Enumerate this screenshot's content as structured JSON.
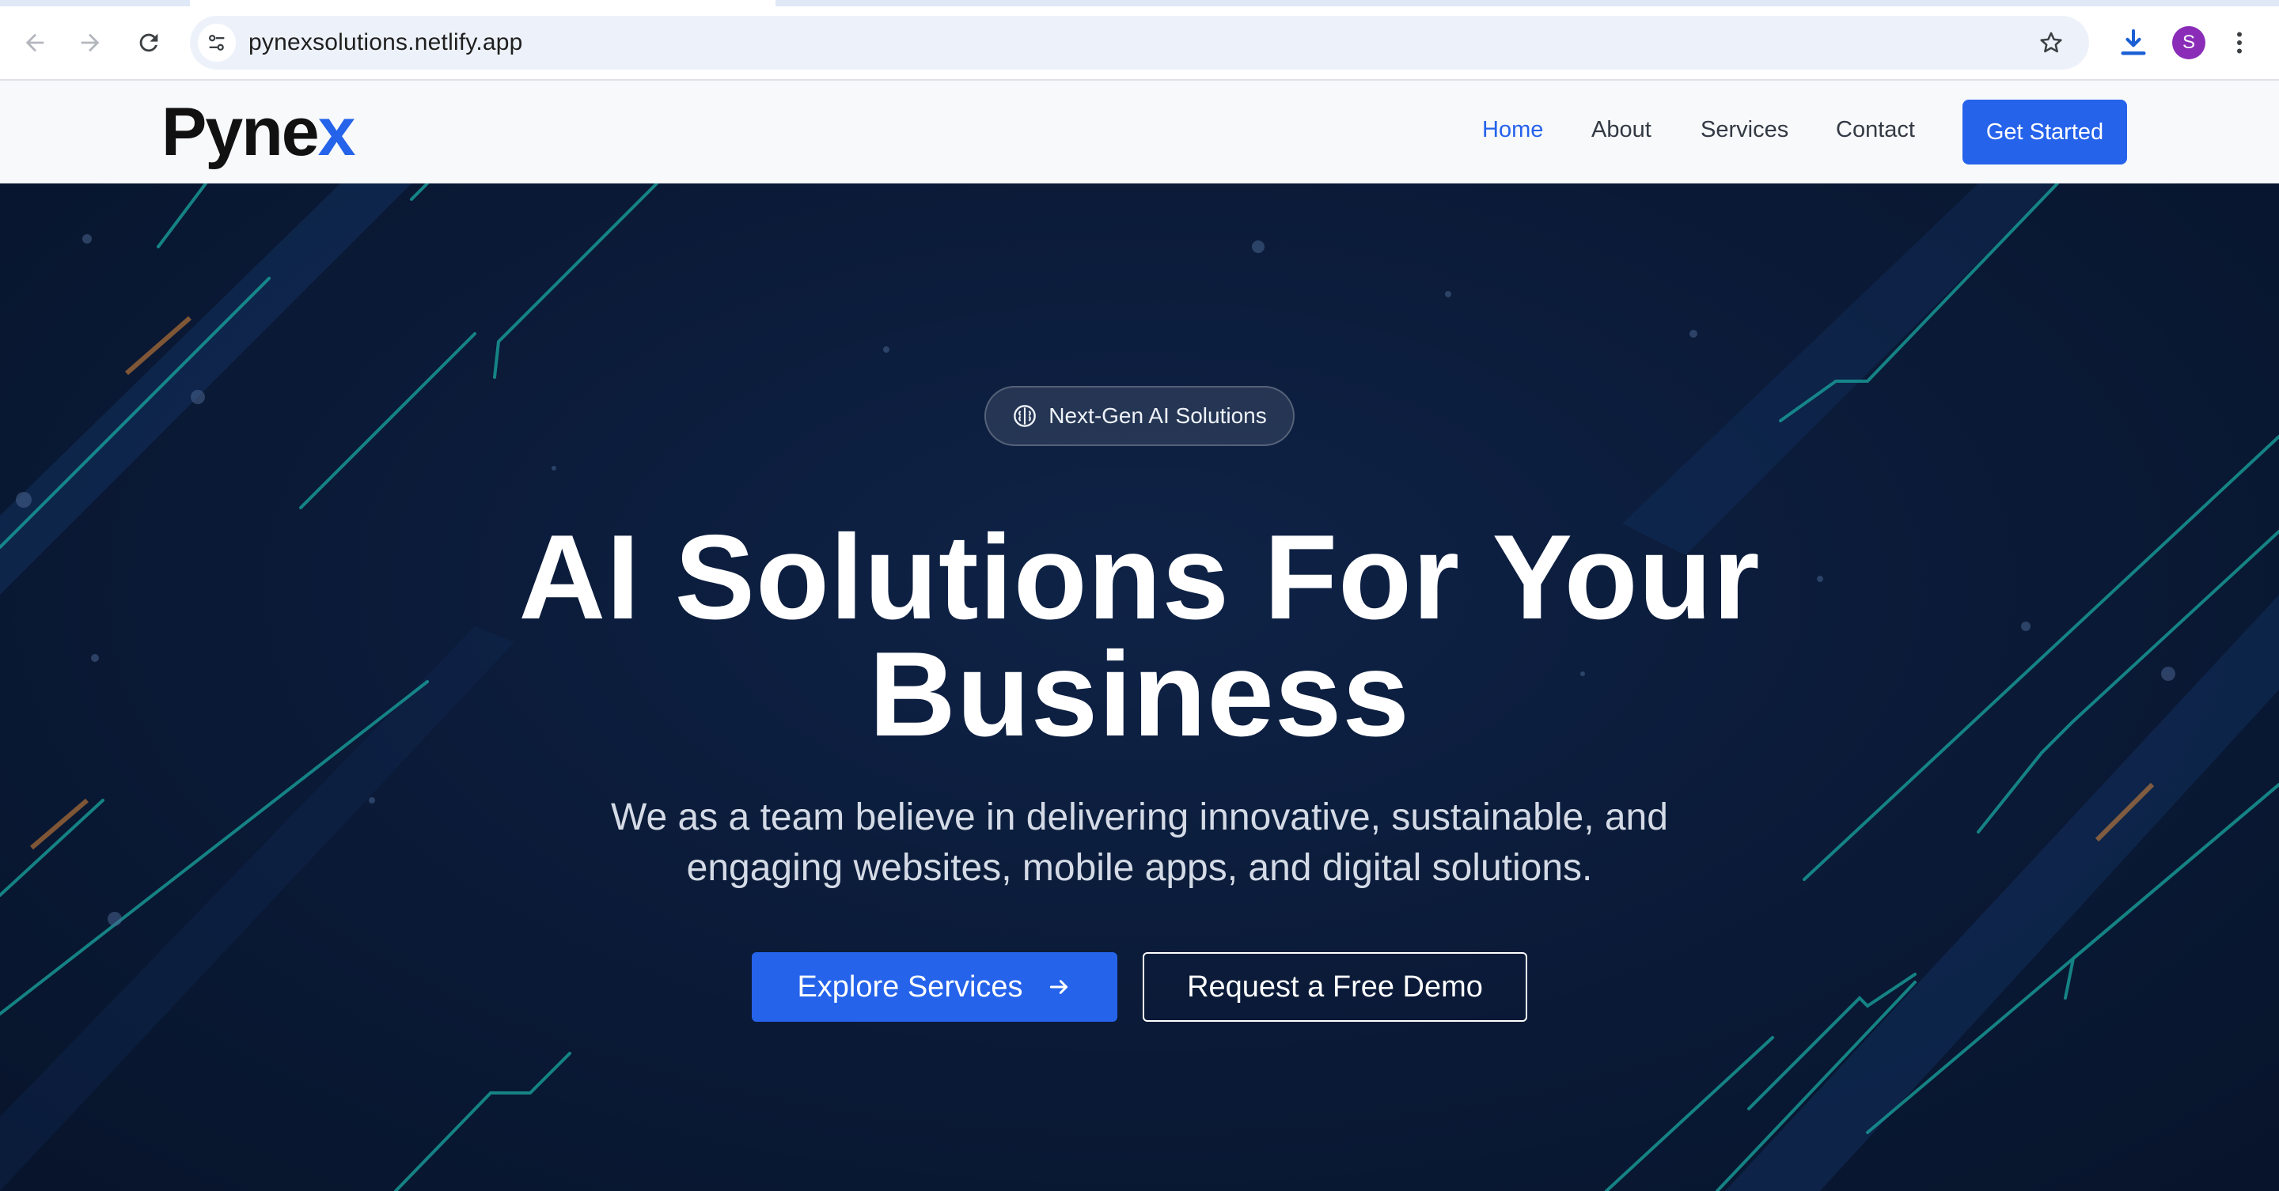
{
  "browser": {
    "url": "pynexsolutions.netlify.app",
    "profile_initial": "S",
    "icons": {
      "back": "arrow-left-icon",
      "forward": "arrow-right-icon",
      "reload": "reload-icon",
      "site_info": "tune-icon",
      "bookmark": "star-icon",
      "downloads": "download-icon",
      "menu": "more-vert-icon"
    }
  },
  "header": {
    "logo_main": "Pyne",
    "logo_accent": "x",
    "nav": [
      {
        "label": "Home",
        "active": true
      },
      {
        "label": "About",
        "active": false
      },
      {
        "label": "Services",
        "active": false
      },
      {
        "label": "Contact",
        "active": false
      }
    ],
    "cta_label": "Get Started"
  },
  "hero": {
    "badge_label": "Next-Gen AI Solutions",
    "badge_icon": "brain-icon",
    "headline_line1": "AI Solutions For Your",
    "headline_line2": "Business",
    "subtext_line1": "We as a team believe in delivering innovative, sustainable, and",
    "subtext_line2": "engaging websites, mobile apps, and digital solutions.",
    "primary_button": "Explore Services",
    "primary_button_icon": "arrow-right-icon",
    "secondary_button": "Request a Free Demo"
  },
  "colors": {
    "accent": "#2563eb",
    "hero_bg": "#0b1b39",
    "circuit_lines": "#1aa7a0",
    "profile": "#8a2cb8"
  }
}
